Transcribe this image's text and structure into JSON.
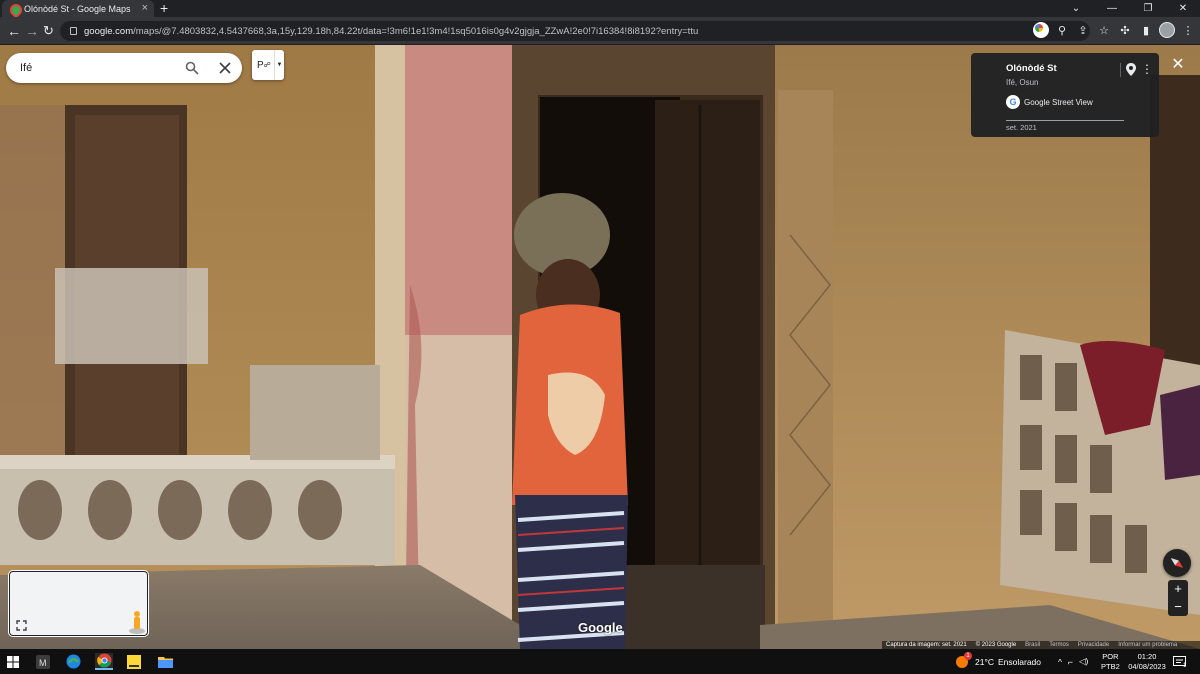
{
  "browser": {
    "tab_title": "Olónòdé St - Google Maps",
    "tab_close": "×",
    "new_tab": "+",
    "url_host": "google.com",
    "url_path": "/maps/@7.4803832,4.5437668,3a,15y,129.18h,84.22t/data=!3m6!1e1!3m4!1sq5016is0g4v2gjgja_ZZwA!2e0!7i16384!8i8192?entry=ttu"
  },
  "maps": {
    "search_value": "Ifé",
    "pegman_button": "P"
  },
  "info_card": {
    "title": "Olónòdé St",
    "subtitle": "Ifé, Osun",
    "source": "Google Street View",
    "date": "set. 2021"
  },
  "street_view": {
    "watermark": "Google",
    "footer": {
      "capture": "Captura da imagem: set. 2021",
      "copyright": "© 2023 Google",
      "country": "Brasil",
      "terms": "Termos",
      "privacy": "Privacidade",
      "report": "Informar um problema"
    }
  },
  "taskbar": {
    "weather_temp": "21°C",
    "weather_desc": "Ensolarado",
    "weather_badge": "1",
    "lang_top": "POR",
    "lang_bottom": "PTB2",
    "time": "01:20",
    "date": "04/08/2023",
    "notification_count": "1",
    "tray_arrow": "^"
  },
  "colors": {
    "accent": "#4285f4",
    "chrome_dark": "#202124",
    "chrome_mid": "#35363a"
  }
}
